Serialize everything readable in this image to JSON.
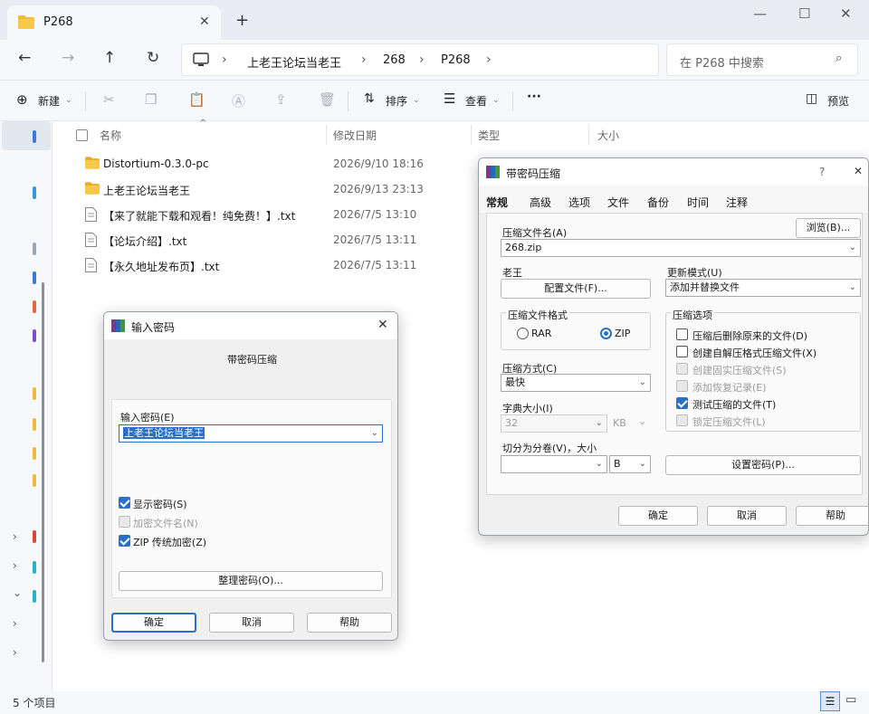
{
  "explorer": {
    "tab_title": "P268",
    "tab_close": "✕",
    "new_tab": "+",
    "window_controls": [
      "—",
      "☐",
      "✕"
    ],
    "breadcrumbs": [
      "上老王论坛当老王",
      "268",
      "P268"
    ],
    "search_placeholder": "在 P268 中搜索",
    "toolbar": {
      "new_label": "新建",
      "sort_label": "排序",
      "view_label": "查看",
      "more_label": "···",
      "preview_label": "预览"
    },
    "columns": {
      "name": "名称",
      "date": "修改日期",
      "type": "类型",
      "size": "大小"
    },
    "files": [
      {
        "name": "Distortium-0.3.0-pc",
        "date": "2026/9/10 18:16",
        "kind": "folder"
      },
      {
        "name": "上老王论坛当老王",
        "date": "2026/9/13 23:13",
        "kind": "folder"
      },
      {
        "name": "【来了就能下载和观看！纯免费！】.txt",
        "date": "2026/7/5 13:10",
        "kind": "txt"
      },
      {
        "name": "【论坛介绍】.txt",
        "date": "2026/7/5 13:11",
        "kind": "txt"
      },
      {
        "name": "【永久地址发布页】.txt",
        "date": "2026/7/5 13:11",
        "kind": "txt"
      }
    ],
    "status_count": "5 个项目"
  },
  "archive_dialog": {
    "title": "带密码压缩",
    "help_icon": "?",
    "tabs": [
      "常规",
      "高级",
      "选项",
      "文件",
      "备份",
      "时间",
      "注释"
    ],
    "archive_name_label": "压缩文件名(A)",
    "browse_label": "浏览(B)...",
    "archive_name_value": "268.zip",
    "profile_group_label": "老王",
    "profile_button": "配置文件(F)...",
    "update_mode_label": "更新模式(U)",
    "update_mode_value": "添加并替换文件",
    "format_label": "压缩文件格式",
    "format_rar": "RAR",
    "format_zip": "ZIP",
    "options_label": "压缩选项",
    "options": [
      {
        "label": "压缩后删除原来的文件(D)",
        "checked": false,
        "disabled": false
      },
      {
        "label": "创建自解压格式压缩文件(X)",
        "checked": false,
        "disabled": false
      },
      {
        "label": "创建固实压缩文件(S)",
        "checked": false,
        "disabled": true
      },
      {
        "label": "添加恢复记录(E)",
        "checked": false,
        "disabled": true
      },
      {
        "label": "测试压缩的文件(T)",
        "checked": true,
        "disabled": false
      },
      {
        "label": "锁定压缩文件(L)",
        "checked": false,
        "disabled": true
      }
    ],
    "method_label": "压缩方式(C)",
    "method_value": "最快",
    "dict_label": "字典大小(I)",
    "dict_value": "32",
    "dict_unit": "KB",
    "split_label": "切分为分卷(V)，大小",
    "split_value": "",
    "split_unit": "B",
    "set_password_button": "设置密码(P)...",
    "ok": "确定",
    "cancel": "取消",
    "help": "帮助"
  },
  "password_dialog": {
    "title": "输入密码",
    "subtitle": "带密码压缩",
    "password_label": "输入密码(E)",
    "password_value": "上老王论坛当老王",
    "show_password": "显示密码(S)",
    "encrypt_names": "加密文件名(N)",
    "zip_legacy": "ZIP 传统加密(Z)",
    "organize_button": "整理密码(O)...",
    "ok": "确定",
    "cancel": "取消",
    "help": "帮助",
    "close_icon": "✕"
  }
}
